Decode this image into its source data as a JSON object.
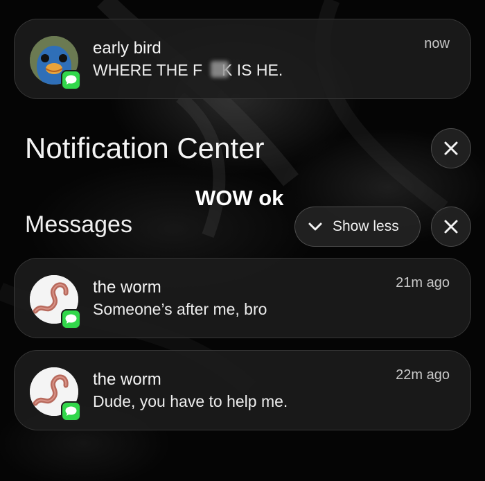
{
  "notifications_top": {
    "sender": "early bird",
    "message_prefix": "WHERE THE F",
    "message_suffix": "K IS HE.",
    "time": "now",
    "app_icon": "messages-icon"
  },
  "notification_center": {
    "title": "Notification Center",
    "close_icon": "close-icon"
  },
  "overlay_caption": "WOW ok",
  "messages_group": {
    "heading": "Messages",
    "show_less_label": "Show less",
    "show_less_icon": "chevron-down-icon",
    "close_icon": "close-icon",
    "items": [
      {
        "sender": "the worm",
        "message": "Someone’s after me, bro",
        "time": "21m ago",
        "app_icon": "messages-icon"
      },
      {
        "sender": "the worm",
        "message": "Dude, you have to help me.",
        "time": "22m ago",
        "app_icon": "messages-icon"
      }
    ]
  },
  "colors": {
    "background": "#050505",
    "card": "#1c1c1c",
    "messages_green": "#32d74b",
    "text": "#f2f2f2",
    "muted_text": "#c8c8c8"
  }
}
